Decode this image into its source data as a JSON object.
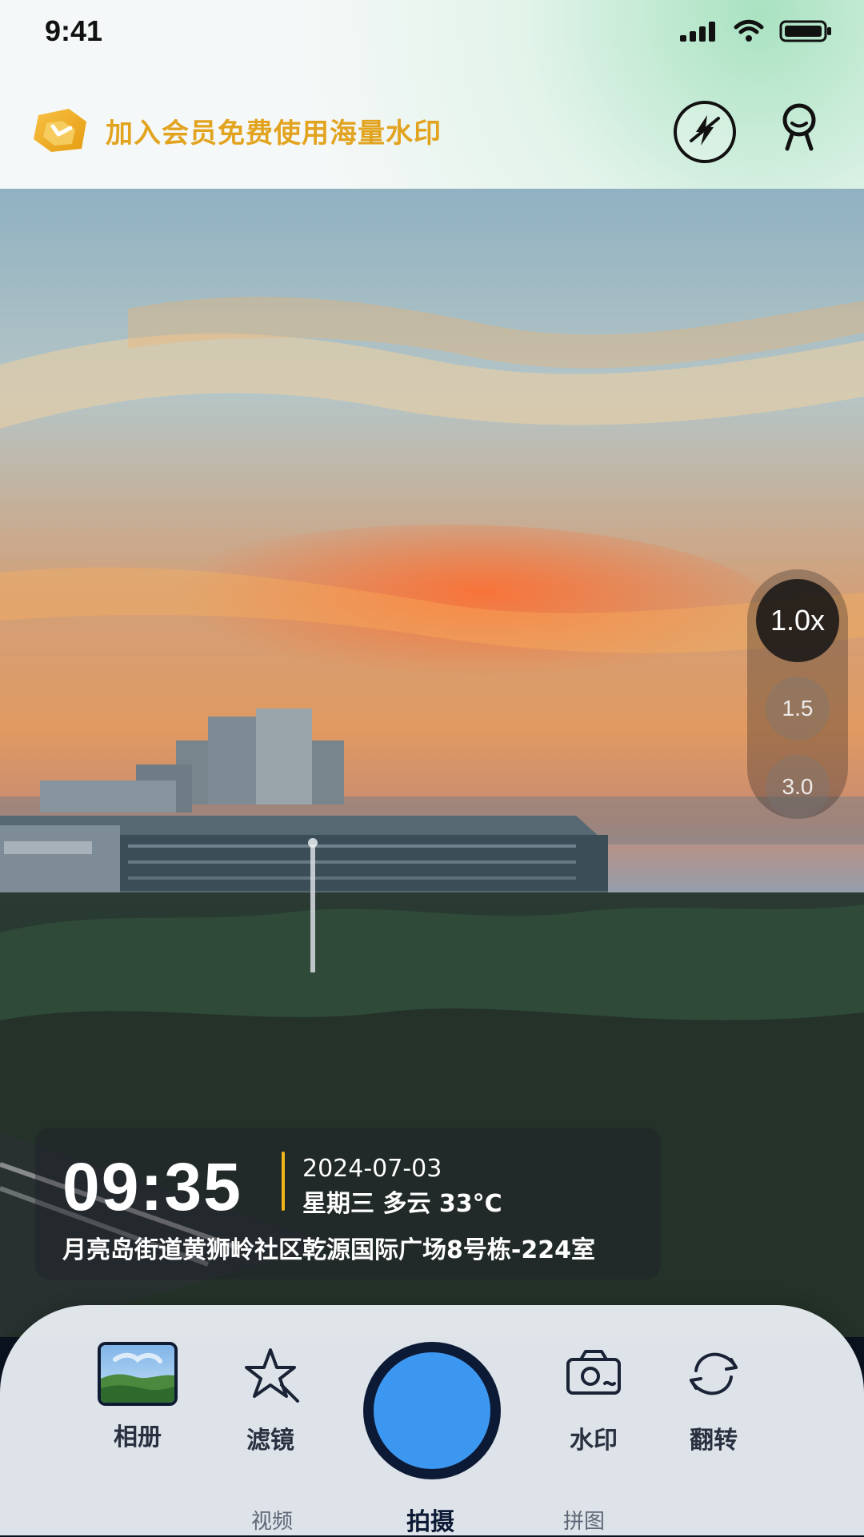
{
  "status_bar": {
    "time": "9:41"
  },
  "promo": {
    "text": "加入会员免费使用海量水印"
  },
  "top_actions": {
    "flash_icon": "flash-off-icon",
    "profile_icon": "profile-icon"
  },
  "zoom": {
    "options": [
      "1.0x",
      "1.5",
      "3.0"
    ],
    "active": "1.0x"
  },
  "watermark": {
    "time": "09:35",
    "date": "2024-07-03",
    "weather": "星期三 多云 33°C",
    "address": "月亮岛街道黄狮岭社区乾源国际广场8号栋-224室",
    "accent_color": "#f1b51c"
  },
  "toolbar": {
    "album_label": "相册",
    "filter_label": "滤镜",
    "watermark_label": "水印",
    "flip_label": "翻转"
  },
  "modes": {
    "video": "视频",
    "photo": "拍摄",
    "collage": "拼图"
  },
  "colors": {
    "brand_gold": "#e2a31f",
    "shutter_inner": "#3c97f0",
    "shutter_ring": "#0c1a35"
  }
}
